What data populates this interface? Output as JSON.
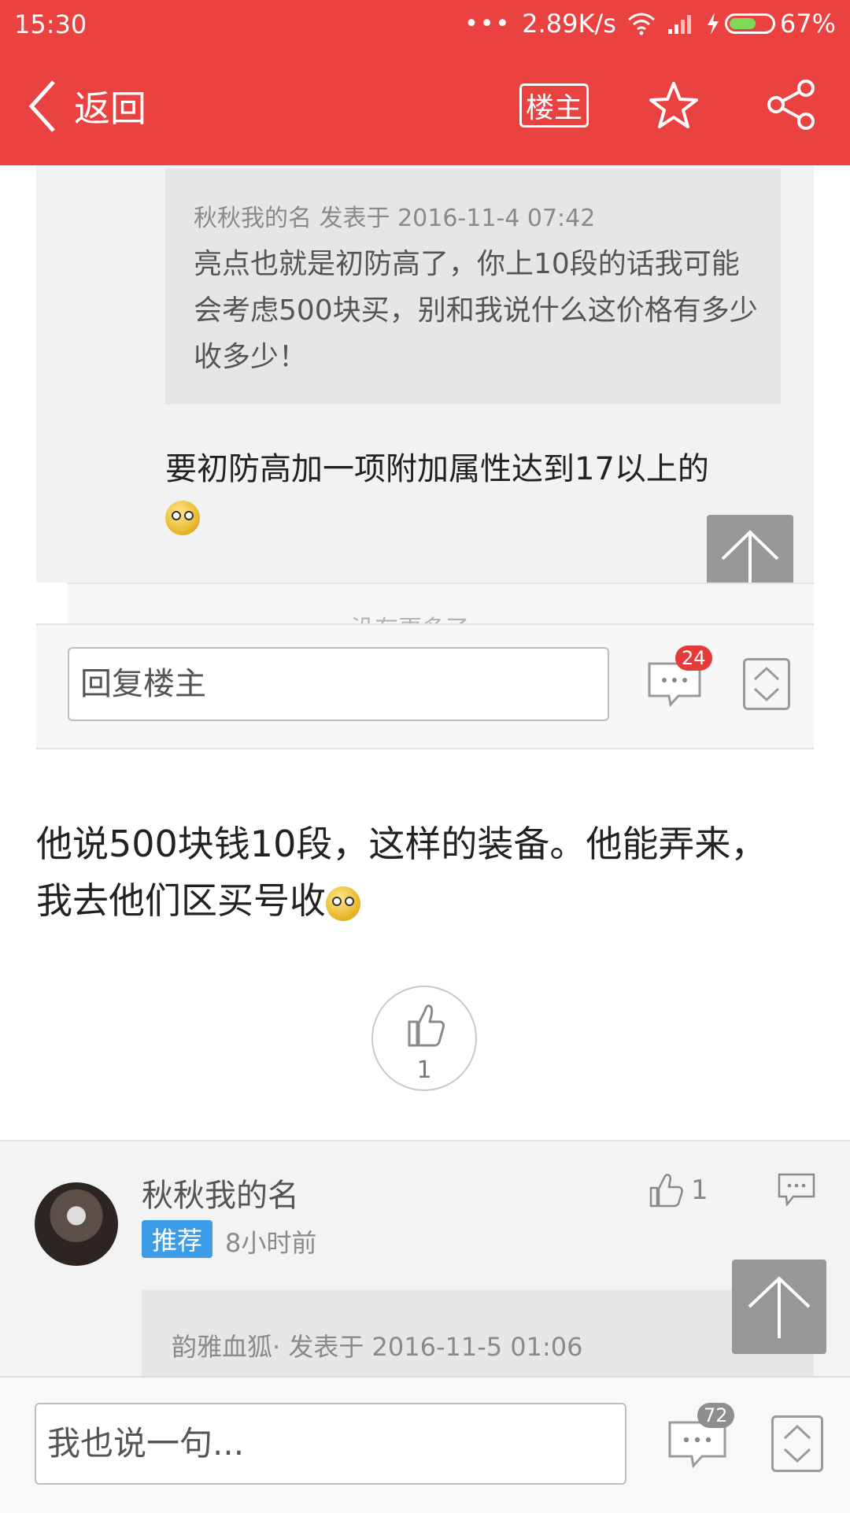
{
  "status_bar": {
    "time": "15:30",
    "network_speed": "2.89K/s",
    "battery_percent": "67%",
    "battery_level": 0.67
  },
  "nav": {
    "back_label": "返回",
    "owner_label": "楼主",
    "star_icon": "star-icon",
    "share_icon": "share-icon"
  },
  "quote": {
    "meta": "秋秋我的名 发表于 2016-11-4 07:42",
    "text": "亮点也就是初防高了，你上10段的话我可能会考虑500块买，别和我说什么这价格有多少收多少！"
  },
  "reply": {
    "text": "要初防高加一项附加属性达到17以上的"
  },
  "more_text": "没有更多了",
  "reply_bar": {
    "placeholder": "回复楼主",
    "comment_count": "24"
  },
  "main_post": {
    "text": "他说500块钱10段，这样的装备。他能弄来，我去他们区买号收"
  },
  "like": {
    "count": "1"
  },
  "comment": {
    "author": "秋秋我的名",
    "tag": "推荐",
    "time": "8小时前",
    "like_count": "1",
    "quote_meta": "韵雅血狐· 发表于 2016-11-5 01:06"
  },
  "bottom_bar": {
    "placeholder": "我也说一句...",
    "comment_count": "72"
  },
  "colors": {
    "brand_red": "#ea4141",
    "tag_blue": "#3b9de8"
  }
}
